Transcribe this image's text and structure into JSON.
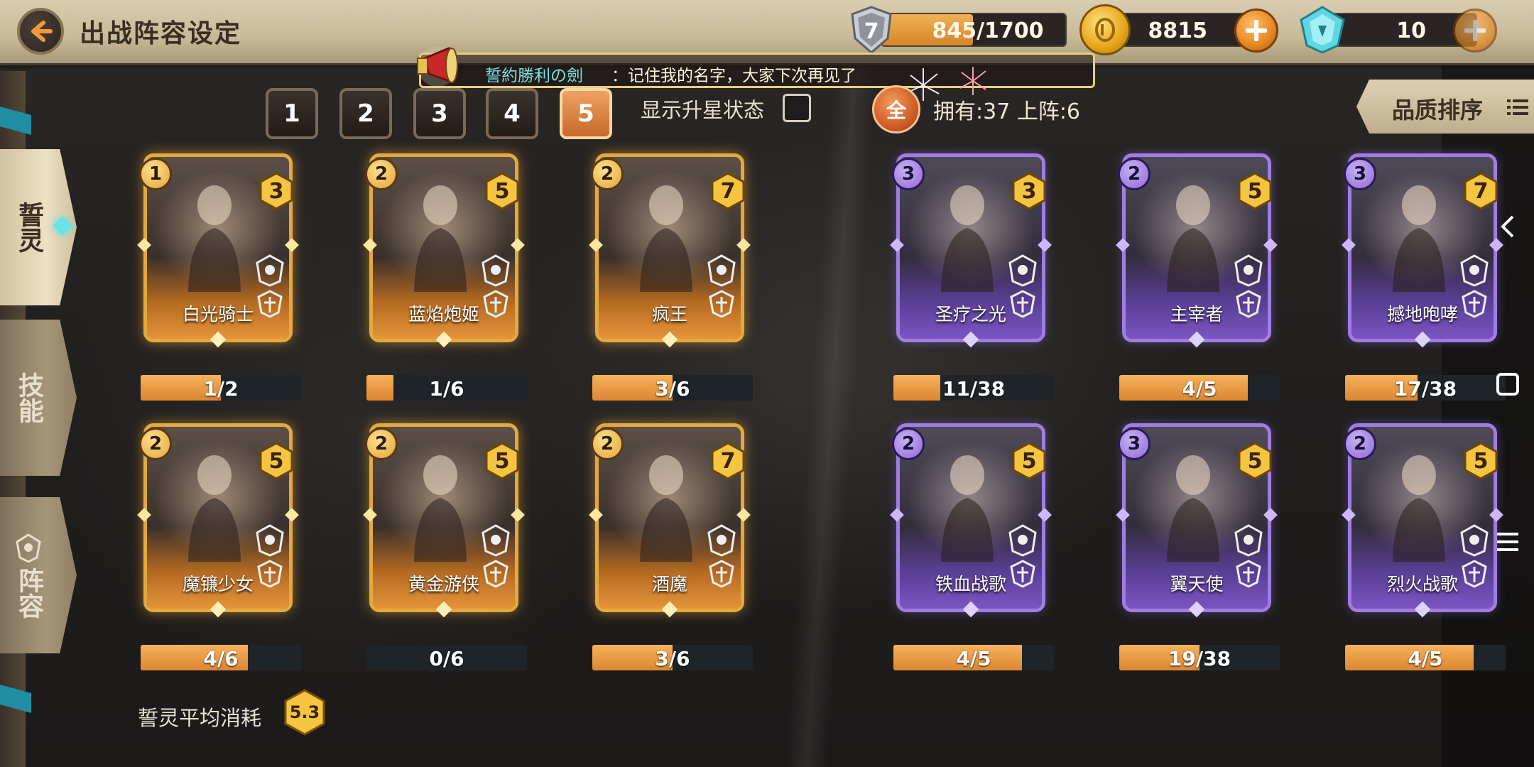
{
  "header": {
    "title": "出战阵容设定",
    "stamina": {
      "level": "7",
      "current": 845,
      "max": 1700,
      "text": "845/1700"
    },
    "gold": "8815",
    "gems": "10"
  },
  "announcement": {
    "name": "誓約勝利の劍",
    "message": "：记住我的名字，大家下次再见了"
  },
  "page_tabs": [
    "1",
    "2",
    "3",
    "4",
    "5"
  ],
  "active_page": "5",
  "star_toggle_label": "显示升星状态",
  "filter_all": "全",
  "owned_label": "拥有:37  上阵:6",
  "sort_label": "品质排序",
  "side_nav": [
    {
      "label": "誓灵",
      "active": true
    },
    {
      "label": "技能",
      "active": false
    },
    {
      "label": "阵容",
      "active": false
    }
  ],
  "left_cards": [
    {
      "name": "白光骑士",
      "level": "1",
      "cost": "3",
      "progress": "1/2",
      "fraction": 0.5
    },
    {
      "name": "蓝焰炮姬",
      "level": "2",
      "cost": "5",
      "progress": "1/6",
      "fraction": 0.17
    },
    {
      "name": "疯王",
      "level": "2",
      "cost": "7",
      "progress": "3/6",
      "fraction": 0.5
    },
    {
      "name": "魔镰少女",
      "level": "2",
      "cost": "5",
      "progress": "4/6",
      "fraction": 0.67
    },
    {
      "name": "黄金游侠",
      "level": "2",
      "cost": "5",
      "progress": "0/6",
      "fraction": 0
    },
    {
      "name": "酒魔",
      "level": "2",
      "cost": "7",
      "progress": "3/6",
      "fraction": 0.5
    }
  ],
  "right_cards": [
    {
      "name": "圣疗之光",
      "level": "3",
      "cost": "3",
      "progress": "11/38",
      "fraction": 0.29
    },
    {
      "name": "主宰者",
      "level": "2",
      "cost": "5",
      "progress": "4/5",
      "fraction": 0.8
    },
    {
      "name": "撼地咆哮",
      "level": "3",
      "cost": "7",
      "progress": "17/38",
      "fraction": 0.45
    },
    {
      "name": "铁血战歌",
      "level": "2",
      "cost": "5",
      "progress": "4/5",
      "fraction": 0.8
    },
    {
      "name": "翼天使",
      "level": "3",
      "cost": "5",
      "progress": "19/38",
      "fraction": 0.5
    },
    {
      "name": "烈火战歌",
      "level": "2",
      "cost": "5",
      "progress": "4/5",
      "fraction": 0.8
    }
  ],
  "avg_cost_label": "誓灵平均消耗",
  "avg_cost": "5.3",
  "colors": {
    "accent": "#e6861e",
    "gold_frame": "#e3a93d",
    "purple_frame": "#9e7ee3",
    "teal": "#79e0de"
  },
  "icons": [
    "back-arrow-icon",
    "shield-level-icon",
    "coin-icon",
    "gem-icon",
    "plus-icon",
    "horn-icon",
    "sort-list-icon",
    "class-emblem-icon"
  ]
}
